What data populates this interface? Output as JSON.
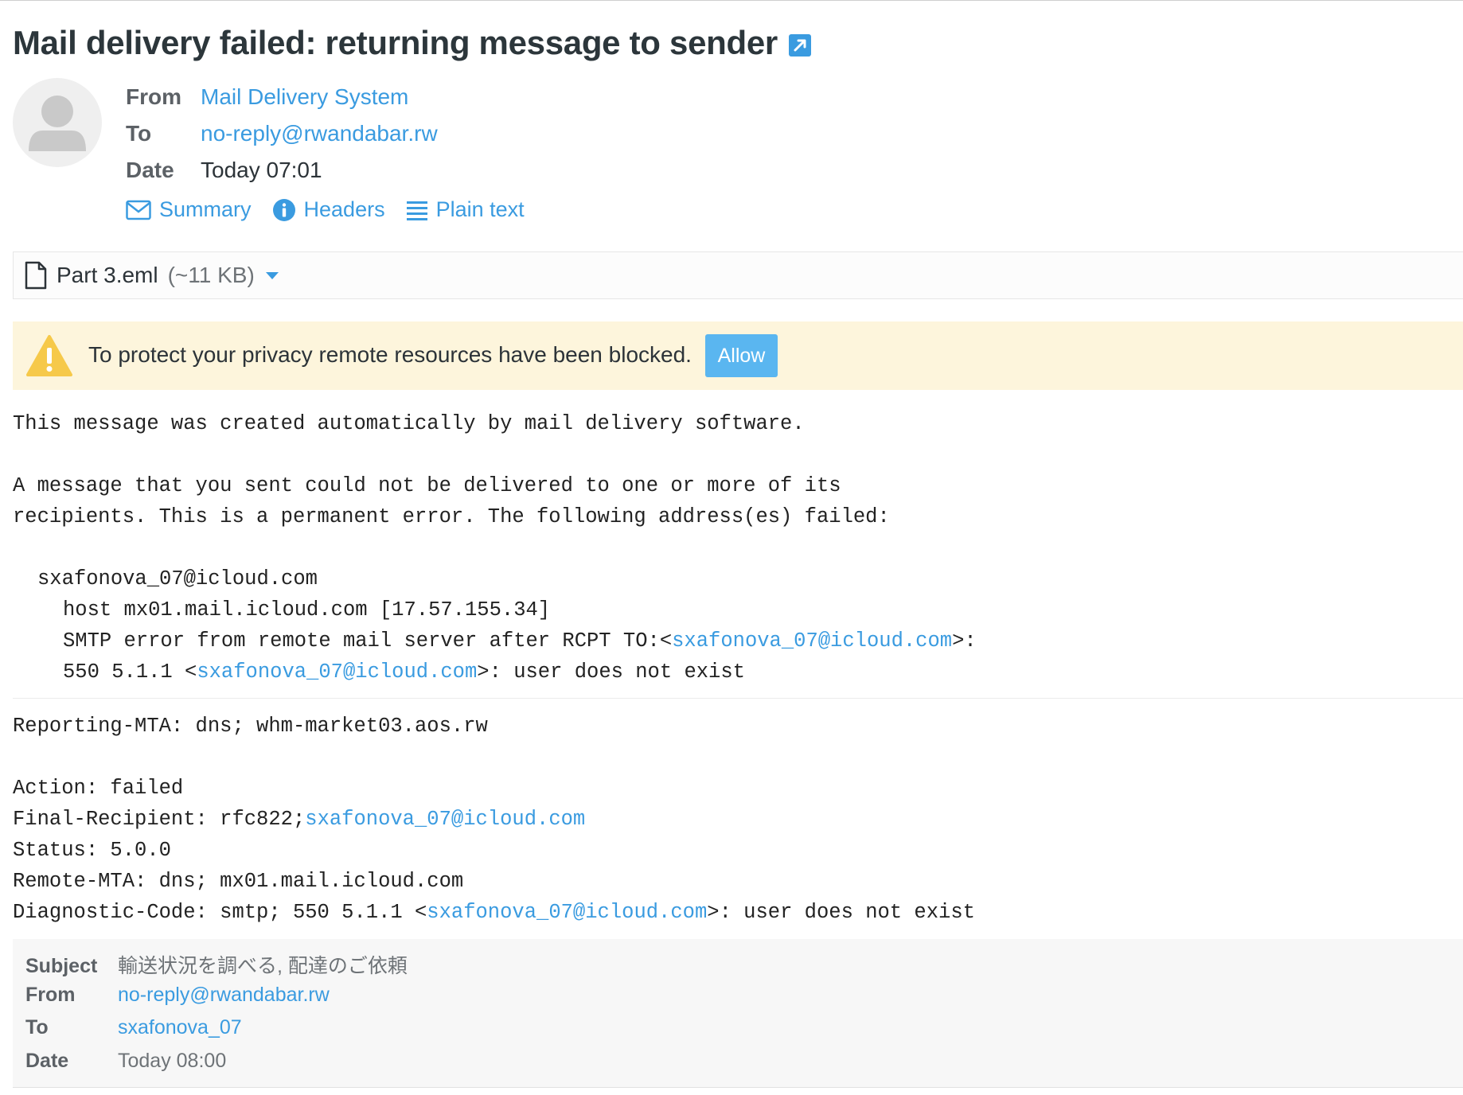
{
  "message": {
    "subject": "Mail delivery failed: returning message to sender",
    "open_new_window_icon": "open-in-new-window-icon",
    "avatar_icon": "person-placeholder-icon",
    "headers": {
      "from_label": "From",
      "from_value": "Mail Delivery System",
      "to_label": "To",
      "to_value": "no-reply@rwandabar.rw",
      "date_label": "Date",
      "date_value": "Today 07:01"
    },
    "views": [
      {
        "label": "Summary",
        "icon": "envelope-icon"
      },
      {
        "label": "Headers",
        "icon": "info-icon"
      },
      {
        "label": "Plain text",
        "icon": "list-lines-icon"
      }
    ]
  },
  "attachment": {
    "name": "Part 3.eml",
    "size": "(~11 KB)",
    "icon": "file-icon"
  },
  "privacy": {
    "text": "To protect your privacy remote resources have been blocked.",
    "allow_label": "Allow",
    "icon": "warning-icon"
  },
  "body": {
    "line1": "This message was created automatically by mail delivery software.",
    "line2": "A message that you sent could not be delivered to one or more of its",
    "line3": "recipients. This is a permanent error. The following address(es) failed:",
    "failed_address": "sxafonova_07@icloud.com",
    "host_line": "host mx01.mail.icloud.com [17.57.155.34]",
    "smtp_prefix": "SMTP error from remote mail server after RCPT TO:<",
    "smtp_address": "sxafonova_07@icloud.com",
    "smtp_suffix": ">:",
    "code_prefix": "550 5.1.1 <",
    "code_address": "sxafonova_07@icloud.com",
    "code_suffix": ">: user does not exist"
  },
  "report": {
    "reporting_mta": "Reporting-MTA: dns; whm-market03.aos.rw",
    "action": "Action: failed",
    "final_prefix": "Final-Recipient: rfc822;",
    "final_address": "sxafonova_07@icloud.com",
    "status": "Status: 5.0.0",
    "remote_mta": "Remote-MTA: dns; mx01.mail.icloud.com",
    "diag_prefix": "Diagnostic-Code: smtp; 550 5.1.1 <",
    "diag_address": "sxafonova_07@icloud.com",
    "diag_suffix": ">: user does not exist"
  },
  "original": {
    "subject_label": "Subject",
    "subject_value": "輸送状況を調べる, 配達のご依頼",
    "from_label": "From",
    "from_value": "no-reply@rwandabar.rw",
    "to_label": "To",
    "to_value": "sxafonova_07",
    "date_label": "Date",
    "date_value": "Today 08:00"
  },
  "colors": {
    "link": "#3a9be0",
    "warning_bg": "#fdf5dc",
    "warning_icon": "#f6c94a",
    "allow_button": "#5ab6f0"
  }
}
